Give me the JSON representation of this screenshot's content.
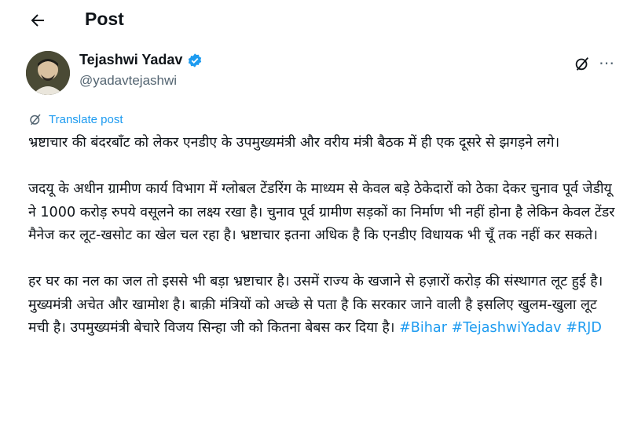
{
  "header": {
    "title": "Post"
  },
  "author": {
    "name": "Tejashwi Yadav",
    "handle": "@yadavtejashwi"
  },
  "translate": {
    "label": "Translate post"
  },
  "post": {
    "paragraphs": [
      "भ्रष्टाचार की बंदरबाँट को लेकर एनडीए के उपमुख्यमंत्री और वरीय मंत्री बैठक में ही एक दूसरे से झगड़ने लगे।",
      "जदयू के अधीन ग्रामीण कार्य विभाग में ग्लोबल टेंडरिंग के माध्यम से केवल बड़े ठेकेदारों को ठेका देकर चुनाव पूर्व जेडीयू ने 1000 करोड़ रुपये वसूलने का लक्ष्य रखा है। चुनाव पूर्व ग्रामीण सड़कों का निर्माण भी नहीं होना है लेकिन केवल टेंडर मैनेज कर लूट-खसोट का खेल चल रहा है। भ्रष्टाचार इतना अधिक है कि एनडीए विधायक भी चूँ तक नहीं कर सकते।",
      "हर घर का नल का जल तो इससे भी बड़ा भ्रष्टाचार है। उसमें राज्य के खजाने से हज़ारों करोड़ की संस्थागत लूट हुई है। मुख्यमंत्री अचेत और खामोश है। बाक़ी मंत्रियों को अच्छे से पता है कि सरकार जाने वाली है इसलिए खुलम-खुला लूट मची है। उपमुख्यमंत्री बेचारे विजय सिन्हा जी को कितना बेबस कर दिया है।"
    ],
    "hashtags": [
      "#Bihar",
      "#TejashwiYadav",
      "#RJD"
    ]
  },
  "colors": {
    "accent": "#1d9bf0",
    "text": "#0f1419",
    "secondary": "#536471"
  },
  "icons": {
    "back": "back-arrow-icon",
    "verified": "verified-badge-icon",
    "grok": "grok-icon",
    "more": "more-icon",
    "translate": "translate-icon"
  }
}
